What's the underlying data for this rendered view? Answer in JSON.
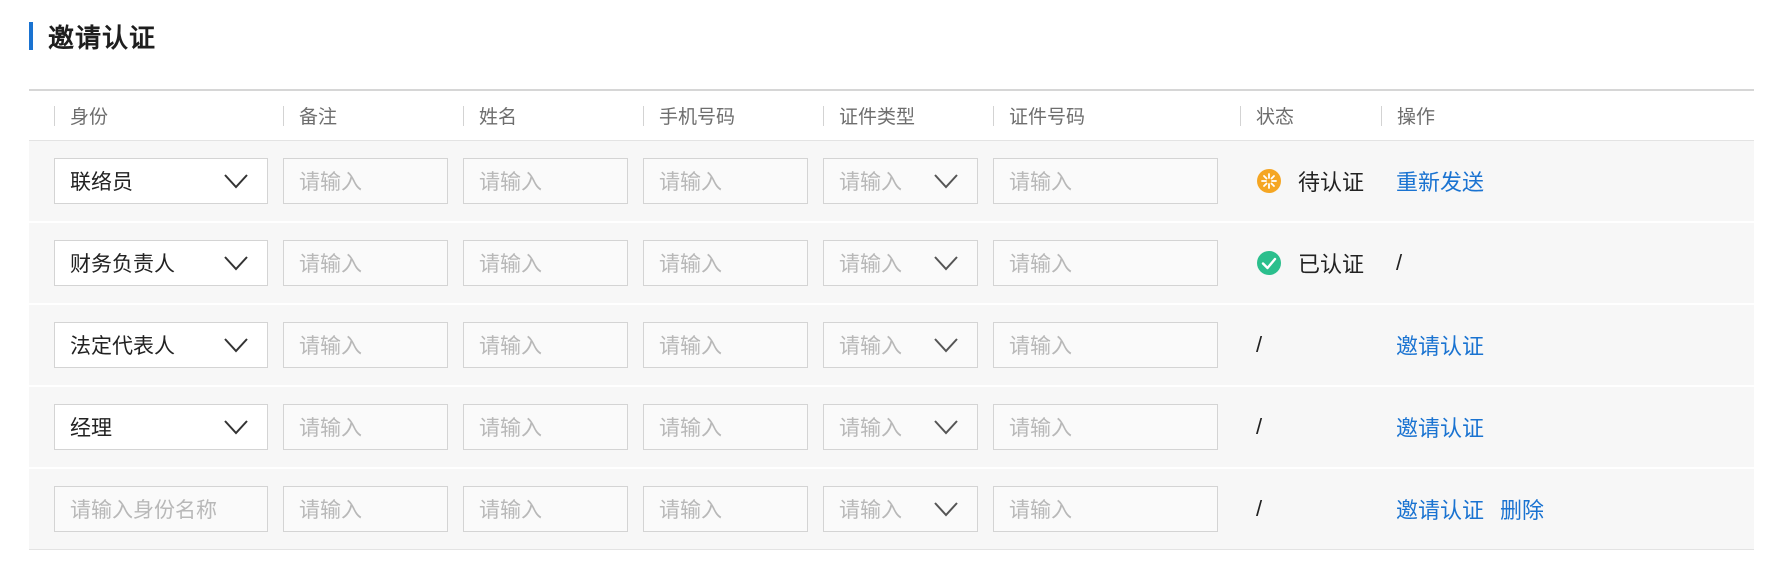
{
  "section": {
    "title": "邀请认证"
  },
  "columns": [
    "身份",
    "备注",
    "姓名",
    "手机号码",
    "证件类型",
    "证件号码",
    "状态",
    "操作"
  ],
  "placeholders": {
    "default": "请输入",
    "identity_name": "请输入身份名称"
  },
  "colors": {
    "accent": "#1a73d1",
    "pending": "#f5a623",
    "verified": "#2bbf8d"
  },
  "rows": [
    {
      "identity": "联络员",
      "status_icon": "pending-icon",
      "status": "待认证",
      "action": "重新发送"
    },
    {
      "identity": "财务负责人",
      "status_icon": "verified-check-icon",
      "status": "已认证",
      "action": "/"
    },
    {
      "identity": "法定代表人",
      "status": "/",
      "action": "邀请认证"
    },
    {
      "identity": "经理",
      "status": "/",
      "action": "邀请认证"
    },
    {
      "identity": "",
      "status": "/",
      "action": "邀请认证",
      "delete": "删除"
    }
  ]
}
